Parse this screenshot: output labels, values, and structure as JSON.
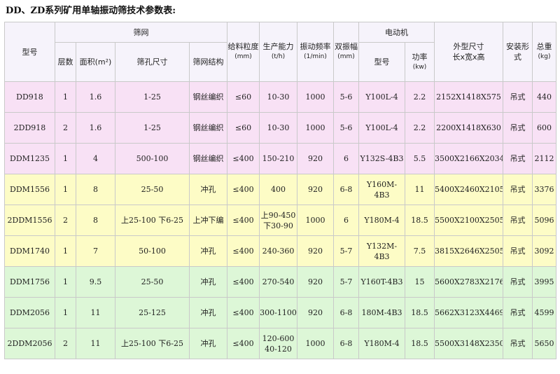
{
  "title": "DD、ZD系列矿用单轴振动筛技术参数表:",
  "header": {
    "model": "型号",
    "screen_group": "筛网",
    "layers": "层数",
    "area": "面积(m²)",
    "hole_size": "筛孔尺寸",
    "mesh_structure": "筛网结构",
    "feed_size": "给料粒度",
    "feed_unit": "(mm)",
    "capacity": "生产能力",
    "capacity_unit": "(t/h)",
    "frequency": "振动频率",
    "frequency_unit": "(1/min)",
    "amplitude": "双振幅",
    "amplitude_unit": "(mm)",
    "motor_group": "电动机",
    "motor_model": "型号",
    "power": "功率",
    "power_unit": "(kw)",
    "dimensions": "外型尺寸",
    "dimensions_sub": "长x宽x高",
    "install": "安装形式",
    "weight": "总重",
    "weight_unit": "(kg)"
  },
  "rows": [
    {
      "band": "pink",
      "model": "DD918",
      "layers": "1",
      "area": "1.6",
      "hole": "1-25",
      "mesh": "钢丝编织",
      "feed": "≤60",
      "capacity": "10-30",
      "freq": "1000",
      "amp": "5-6",
      "motor": "Y100L-4",
      "power": "2.2",
      "dims": "2152X1418X575",
      "install": "吊式",
      "weight": "440"
    },
    {
      "band": "pink",
      "model": "2DD918",
      "layers": "2",
      "area": "1.6",
      "hole": "1-25",
      "mesh": "钢丝编织",
      "feed": "≤60",
      "capacity": "10-30",
      "freq": "1000",
      "amp": "5-6",
      "motor": "Y100L-4",
      "power": "2.2",
      "dims": "2200X1418X630",
      "install": "吊式",
      "weight": "600"
    },
    {
      "band": "pink",
      "model": "DDM1235",
      "layers": "1",
      "area": "4",
      "hole": "500-100",
      "mesh": "钢丝编织",
      "feed": "≤400",
      "capacity": "150-210",
      "freq": "920",
      "amp": "6",
      "motor": "Y132S-4B3",
      "power": "5.5",
      "dims": "3500X2166X2034",
      "install": "吊式",
      "weight": "2112"
    },
    {
      "band": "yellow",
      "model": "DDM1556",
      "layers": "1",
      "area": "8",
      "hole": "25-50",
      "mesh": "冲孔",
      "feed": "≤400",
      "capacity": "400",
      "freq": "920",
      "amp": "6-8",
      "motor": "Y160M-4B3",
      "power": "11",
      "dims": "5400X2460X2105",
      "install": "吊式",
      "weight": "3376"
    },
    {
      "band": "yellow",
      "model": "2DDM1556",
      "layers": "2",
      "area": "8",
      "hole": "上25-100 下6-25",
      "mesh": "上冲下编",
      "feed": "≤400",
      "capacity": "上90-450 下30-90",
      "freq": "1000",
      "amp": "6",
      "motor": "Y180M-4",
      "power": "18.5",
      "dims": "5500X2100X2505",
      "install": "吊式",
      "weight": "5096"
    },
    {
      "band": "yellow",
      "model": "DDM1740",
      "layers": "1",
      "area": "7",
      "hole": "50-100",
      "mesh": "冲孔",
      "feed": "≤400",
      "capacity": "240-360",
      "freq": "920",
      "amp": "5-7",
      "motor": "Y132M-4B3",
      "power": "7.5",
      "dims": "3815X2646X2505",
      "install": "吊式",
      "weight": "3092"
    },
    {
      "band": "green",
      "model": "DDM1756",
      "layers": "1",
      "area": "9.5",
      "hole": "25-50",
      "mesh": "冲孔",
      "feed": "≤400",
      "capacity": "270-540",
      "freq": "920",
      "amp": "5-7",
      "motor": "Y160T-4B3",
      "power": "15",
      "dims": "5600X2783X2176",
      "install": "吊式",
      "weight": "3995"
    },
    {
      "band": "green",
      "model": "DDM2056",
      "layers": "1",
      "area": "11",
      "hole": "25-125",
      "mesh": "冲孔",
      "feed": "≤400",
      "capacity": "300-1100",
      "freq": "920",
      "amp": "6-8",
      "motor": "180M-4B3",
      "power": "18.5",
      "dims": "5662X3123X4469",
      "install": "吊式",
      "weight": "4599"
    },
    {
      "band": "green",
      "model": "2DDM2056",
      "layers": "2",
      "area": "11",
      "hole": "上25-100 下6-25",
      "mesh": "冲孔",
      "feed": "≤400",
      "capacity": "120-600 40-120",
      "freq": "1000",
      "amp": "6-8",
      "motor": "Y180M-4",
      "power": "18.5",
      "dims": "5500X3148X2350",
      "install": "吊式",
      "weight": "5650"
    }
  ]
}
